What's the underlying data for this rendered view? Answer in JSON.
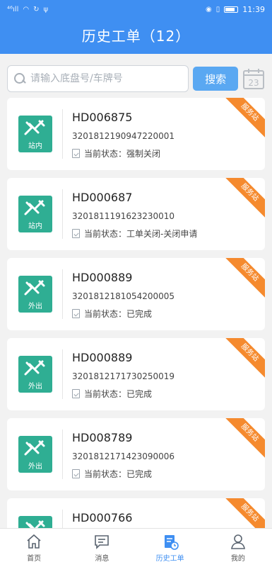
{
  "status_bar": {
    "signal": "⁴⁶ıll",
    "time": "11:39"
  },
  "header": {
    "title": "历史工单（12）"
  },
  "search": {
    "placeholder": "请输入底盘号/车牌号",
    "button_label": "搜索",
    "calendar_day": "23"
  },
  "cards": [
    {
      "order_no": "HD006875",
      "chassis_no": "3201812190947220001",
      "status": "当前状态：强制关闭",
      "tag": "站内",
      "ribbon": "服务站"
    },
    {
      "order_no": "HD000687",
      "chassis_no": "3201811191623230010",
      "status": "当前状态：工单关闭-关闭申请",
      "tag": "站内",
      "ribbon": "服务站"
    },
    {
      "order_no": "HD000889",
      "chassis_no": "3201812181054200005",
      "status": "当前状态：已完成",
      "tag": "外出",
      "ribbon": "服务站"
    },
    {
      "order_no": "HD000889",
      "chassis_no": "3201812171730250019",
      "status": "当前状态：已完成",
      "tag": "外出",
      "ribbon": "服务站"
    },
    {
      "order_no": "HD008789",
      "chassis_no": "3201812171423090006",
      "status": "当前状态：已完成",
      "tag": "外出",
      "ribbon": "服务站"
    },
    {
      "order_no": "HD000766",
      "chassis_no": "",
      "status": "",
      "tag": "",
      "ribbon": "服务站"
    }
  ],
  "nav": [
    {
      "label": "首页",
      "icon": "home-icon"
    },
    {
      "label": "消息",
      "icon": "message-icon"
    },
    {
      "label": "历史工单",
      "icon": "history-order-icon",
      "active": true
    },
    {
      "label": "我的",
      "icon": "profile-icon"
    }
  ],
  "colors": {
    "primary": "#3f8ff2",
    "card_icon": "#2fae93",
    "ribbon": "#f58a2e",
    "search_button": "#5aa8f2"
  }
}
